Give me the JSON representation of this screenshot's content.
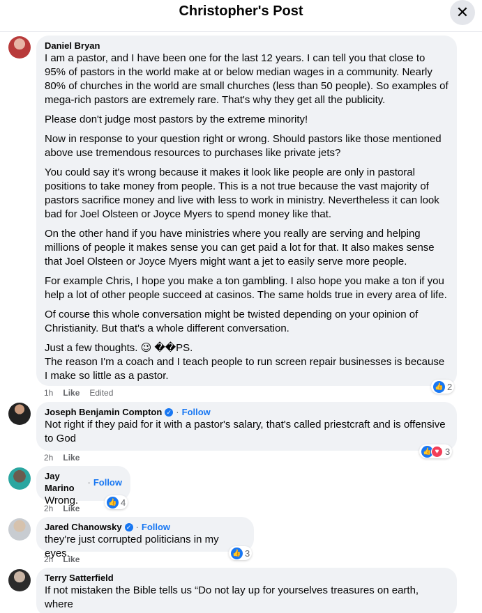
{
  "header": {
    "title": "Christopher's Post",
    "close_symbol": "✕"
  },
  "comments": [
    {
      "author": "Daniel Bryan",
      "paragraphs": [
        "I am a pastor, and I have been one for the last 12 years. I can tell you that close to 95% of pastors in the world make at or below median wages in a community. Nearly 80% of churches in the world are small churches (less than 50 people). So examples of mega-rich pastors are extremely rare. That's why they get all the publicity.",
        "Please don't judge most pastors by the extreme minority!",
        "Now in response to your question right or wrong. Should pastors like those mentioned above use tremendous resources to purchases like private jets?",
        "You could say it's wrong because it makes it look like people are only in pastoral positions to take money from people. This is a not true because the vast majority of pastors sacrifice money and live with less to work in ministry. Nevertheless it can look bad for Joel Olsteen or Joyce Myers to spend money like that.",
        "On the other hand if you have ministries where you really are serving and helping millions of people it makes sense you can get paid a lot for that. It also makes sense that Joel Olsteen or Joyce Myers might want a jet to easily serve more people.",
        "For example Chris, I hope you make a ton gambling. I also hope you make a ton if you help a lot of other people succeed at casinos. The same holds true in every area of life.",
        "Of course this whole conversation might be twisted depending on your opinion of Christianity. But that's a whole different conversation."
      ],
      "last_line_1": "Just a few thoughts. 😉 ��PS.",
      "last_line_2": "The reason I'm a coach and I teach people to run screen repair businesses is because I make so little as a pastor.",
      "time": "1h",
      "like_label": "Like",
      "edited_label": "Edited",
      "reaction_count": "2"
    },
    {
      "author": "Joseph Benjamin Compton",
      "follow_label": "Follow",
      "text": "Not right if they paid for it with a pastor's salary, that's called priestcraft and is offensive to God",
      "time": "2h",
      "like_label": "Like",
      "reaction_count": "3"
    },
    {
      "author": "Jay Marino",
      "follow_label": "Follow",
      "text": "Wrong.",
      "time": "2h",
      "like_label": "Like",
      "reaction_count": "4"
    },
    {
      "author": "Jared Chanowsky",
      "follow_label": "Follow",
      "text": "they're just corrupted politicians in my eyes.",
      "time": "2h",
      "like_label": "Like",
      "reaction_count": "3"
    },
    {
      "author": "Terry Satterfield",
      "text": "If not mistaken the Bible tells us “Do not lay up for yourselves treasures on earth, where"
    }
  ],
  "colors": {
    "link": "#1877f2",
    "bubble": "#f0f2f5",
    "love": "#f33e58"
  }
}
